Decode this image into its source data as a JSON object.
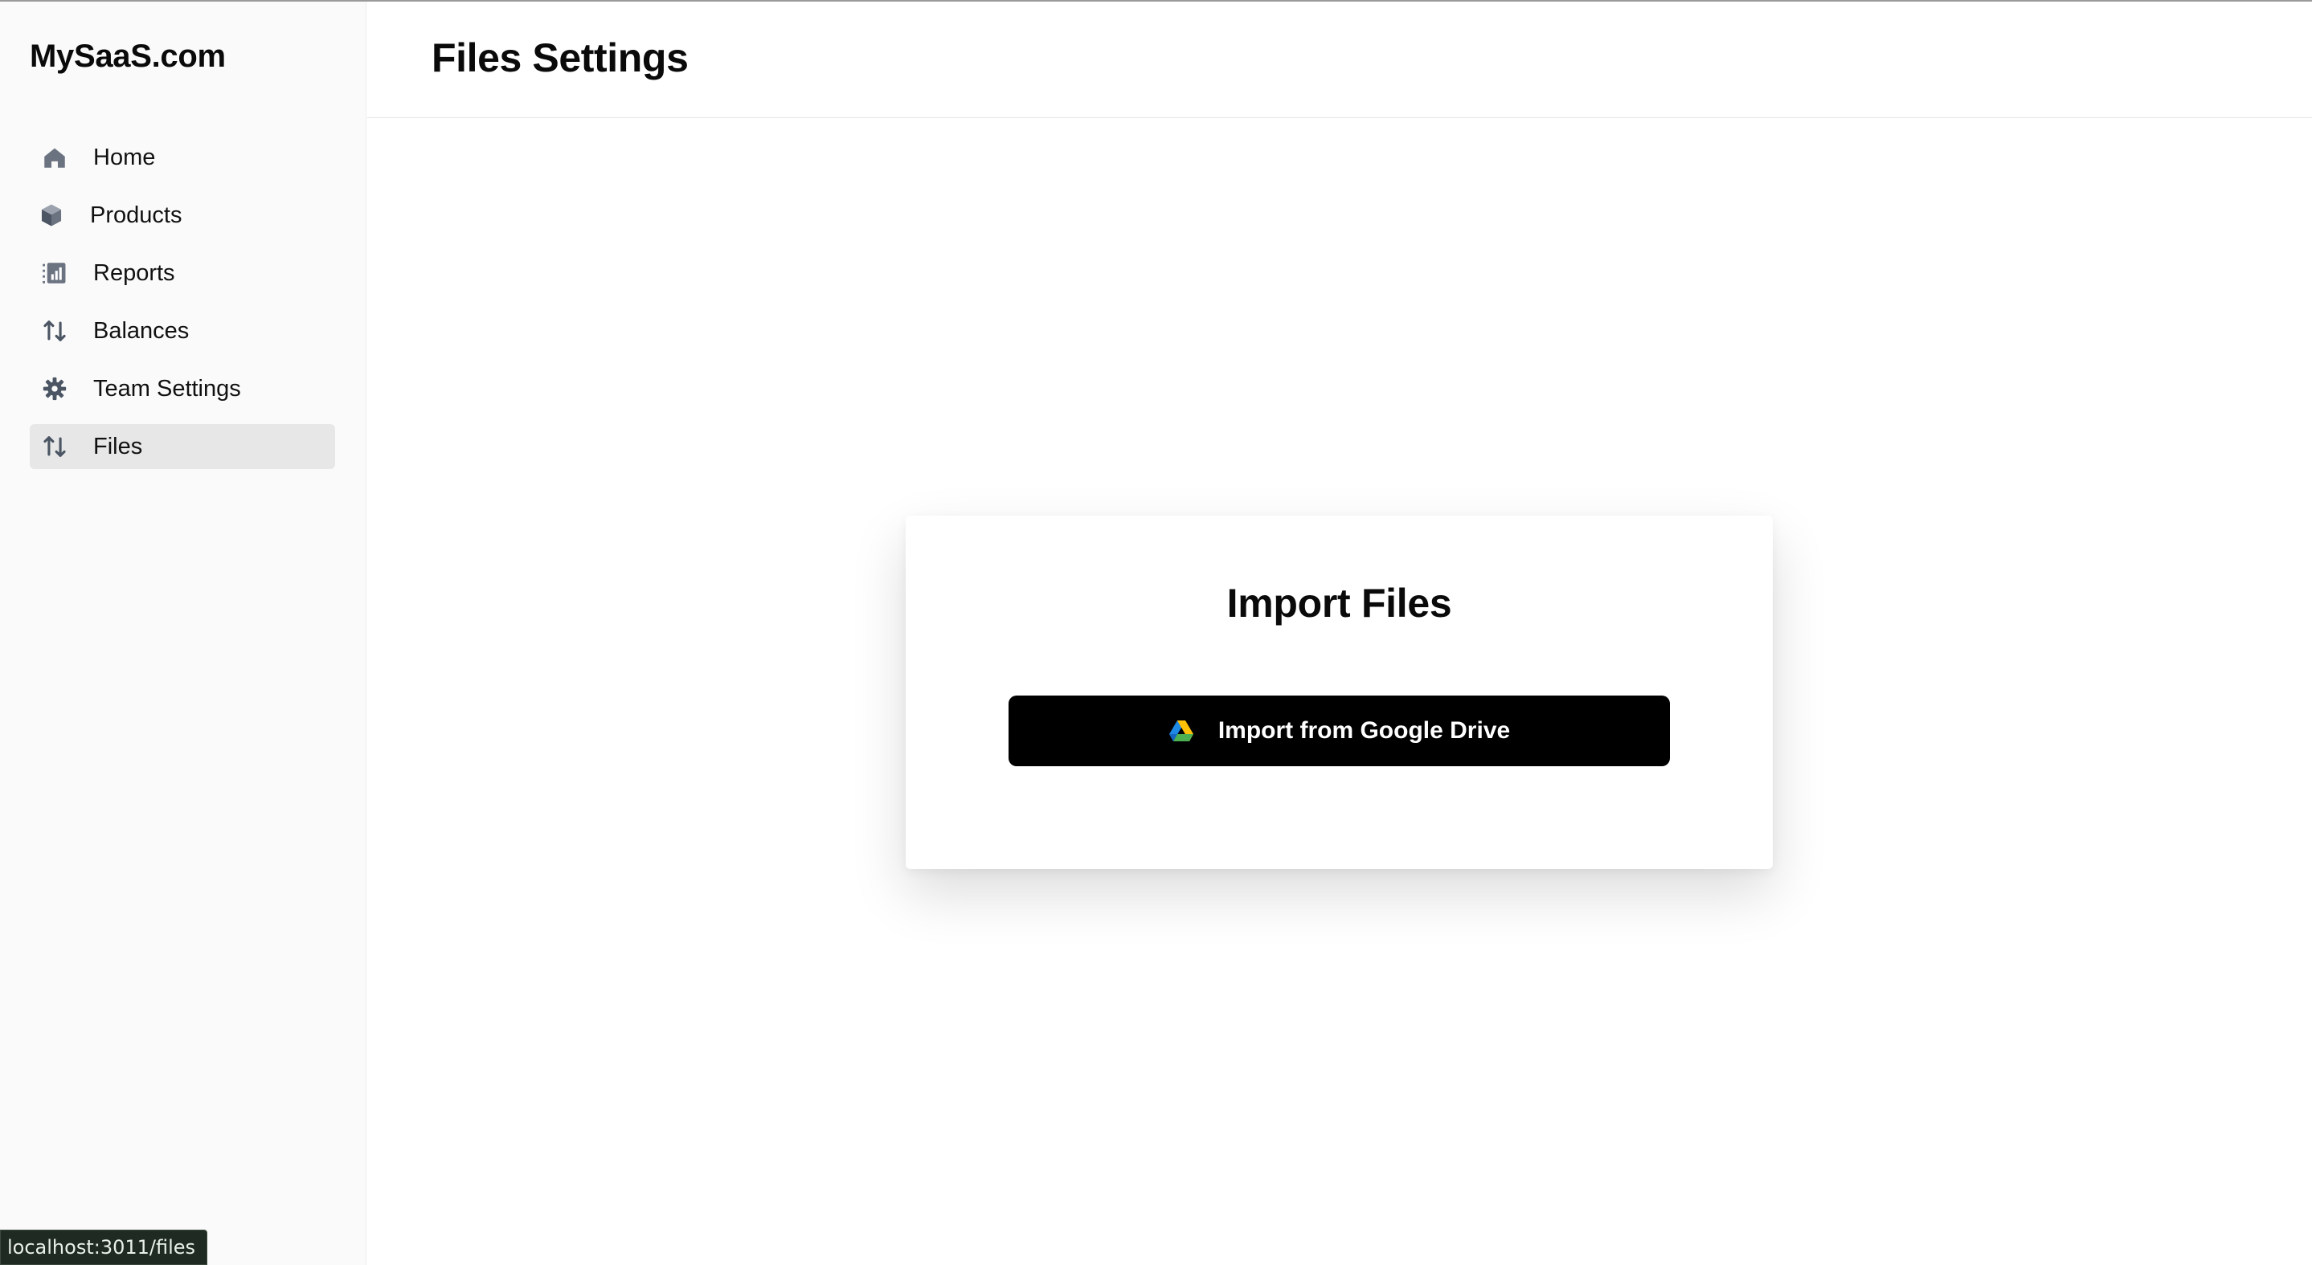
{
  "sidebar": {
    "brand": "MySaaS.com",
    "items": [
      {
        "label": "Home",
        "icon": "home-icon"
      },
      {
        "label": "Products",
        "icon": "cube-icon"
      },
      {
        "label": "Reports",
        "icon": "chart-icon"
      },
      {
        "label": "Balances",
        "icon": "arrows-up-down-icon"
      },
      {
        "label": "Team Settings",
        "icon": "gear-icon"
      },
      {
        "label": "Files",
        "icon": "arrows-up-down-icon",
        "active": true
      }
    ]
  },
  "header": {
    "title": "Files Settings"
  },
  "import_card": {
    "title": "Import Files",
    "button_label": "Import from Google Drive",
    "button_icon": "google-drive-icon"
  },
  "status_bar": {
    "url": "localhost:3011/files"
  },
  "colors": {
    "sidebar_bg": "#fafafa",
    "active_item_bg": "#e7e7e7",
    "button_bg": "#000000",
    "icon_gray": "#6b7280"
  }
}
